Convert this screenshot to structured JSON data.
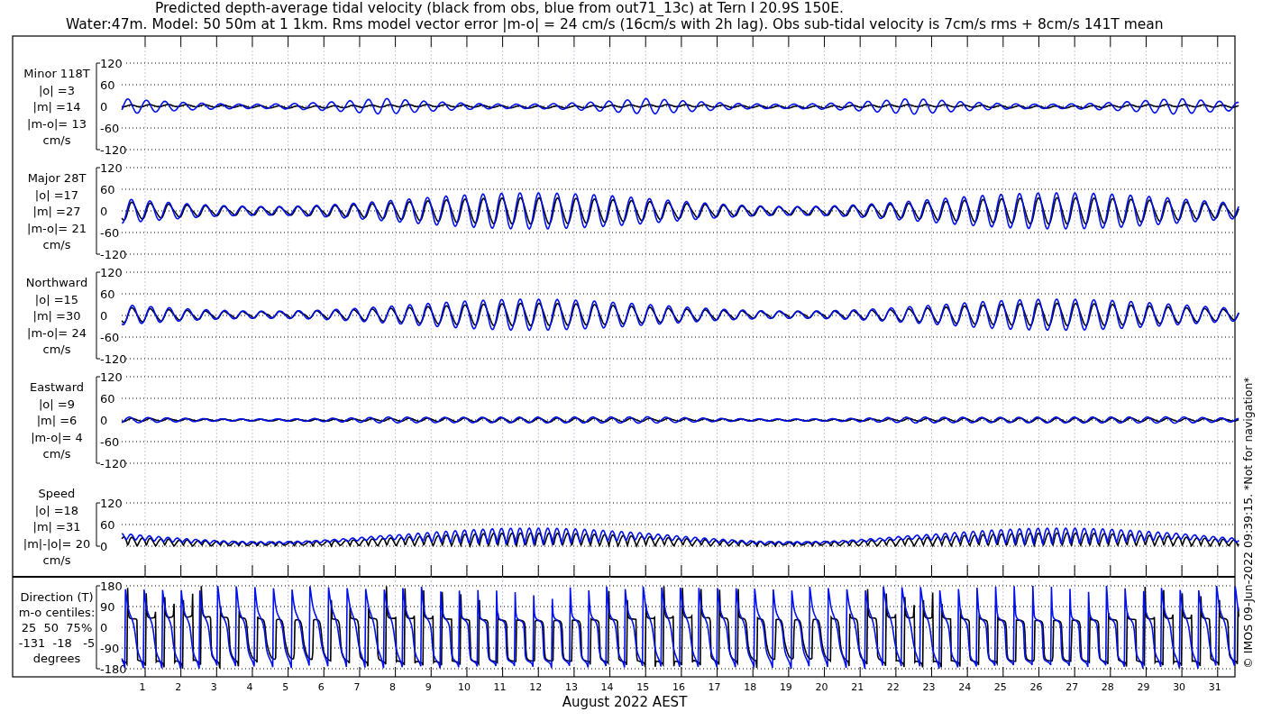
{
  "title_lines": [
    "Predicted depth-average tidal velocity (black from obs, blue from out71_13c) at Tern I 20.9S 150E.",
    "Water:47m. Model: 50 50m at 1 1km. Rms model vector error |m-o| = 24 cm/s (16cm/s with 2h lag). Obs sub-tidal velocity is 7cm/s rms + 8cm/s 141T mean"
  ],
  "panels": [
    {
      "kind": "minor",
      "label_lines": [
        "Minor 118T",
        "|o| =3",
        "|m| =14",
        "|m-o|= 13",
        "cm/s"
      ],
      "yticks": [
        "120",
        "60",
        "0",
        "-60",
        "-120"
      ]
    },
    {
      "kind": "major",
      "label_lines": [
        "Major 28T",
        "|o| =17",
        "|m| =27",
        "|m-o|= 21",
        "cm/s"
      ],
      "yticks": [
        "120",
        "60",
        "0",
        "-60",
        "-120"
      ]
    },
    {
      "kind": "northward",
      "label_lines": [
        "Northward",
        "|o| =15",
        "|m| =30",
        "|m-o|= 24",
        "cm/s"
      ],
      "yticks": [
        "120",
        "60",
        "0",
        "-60",
        "-120"
      ]
    },
    {
      "kind": "eastward",
      "label_lines": [
        "Eastward",
        "|o| =9",
        "|m| =6",
        "|m-o|= 4",
        "cm/s"
      ],
      "yticks": [
        "120",
        "60",
        "0",
        "-60",
        "-120"
      ]
    },
    {
      "kind": "speed",
      "label_lines": [
        "Speed",
        "|o| =18",
        "|m| =31",
        "|m|-|o|= 20",
        "cm/s"
      ],
      "yticks": [
        "120",
        "60",
        "0"
      ]
    },
    {
      "kind": "direction",
      "label_lines": [
        "Direction (T)",
        "m-o centiles:",
        "25  50  75%",
        "-131  -18   -5",
        "degrees"
      ],
      "yticks": [
        "180",
        "90",
        "0",
        "-90",
        "-180"
      ]
    }
  ],
  "xticks": [
    "1",
    "2",
    "3",
    "4",
    "5",
    "6",
    "7",
    "8",
    "9",
    "10",
    "11",
    "12",
    "13",
    "14",
    "15",
    "16",
    "17",
    "18",
    "19",
    "20",
    "21",
    "22",
    "23",
    "24",
    "25",
    "26",
    "27",
    "28",
    "29",
    "30",
    "31"
  ],
  "xlabel": "August 2022 AEST",
  "side_note": "© IMOS 09-Jun-2022 09:39:15. *Not for navigation*"
}
